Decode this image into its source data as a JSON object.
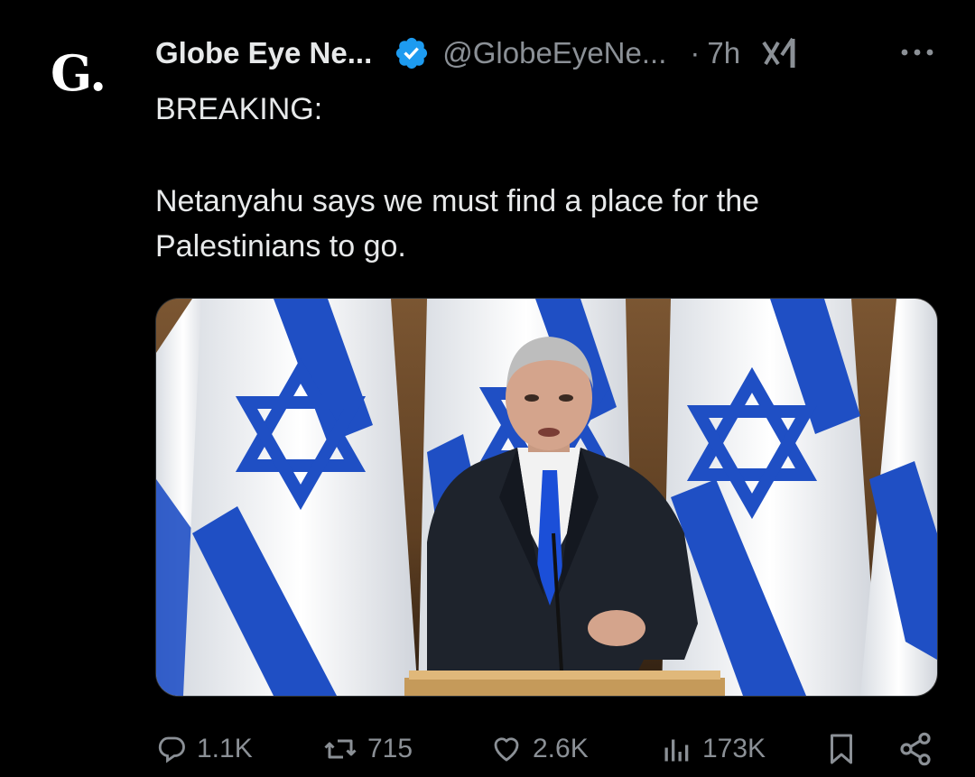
{
  "author": {
    "avatar_letter": "G.",
    "display_name": "Globe Eye Ne...",
    "handle": "@GlobeEyeNe...",
    "separator": "·",
    "time": "7h",
    "verified_color": "#1d9bf0"
  },
  "tweet": {
    "line1": "BREAKING:",
    "line2": "Netanyahu says we must find a place for the Palestinians to go."
  },
  "media": {
    "description_icon": "photo-of-man-speaking-at-podium-before-israeli-flags"
  },
  "actions": {
    "replies": "1.1K",
    "reposts": "715",
    "likes": "2.6K",
    "views": "173K"
  },
  "colors": {
    "background": "#000000",
    "text": "#e7e9ea",
    "secondary": "#8b9096",
    "flag_blue": "#1f4fc4"
  }
}
